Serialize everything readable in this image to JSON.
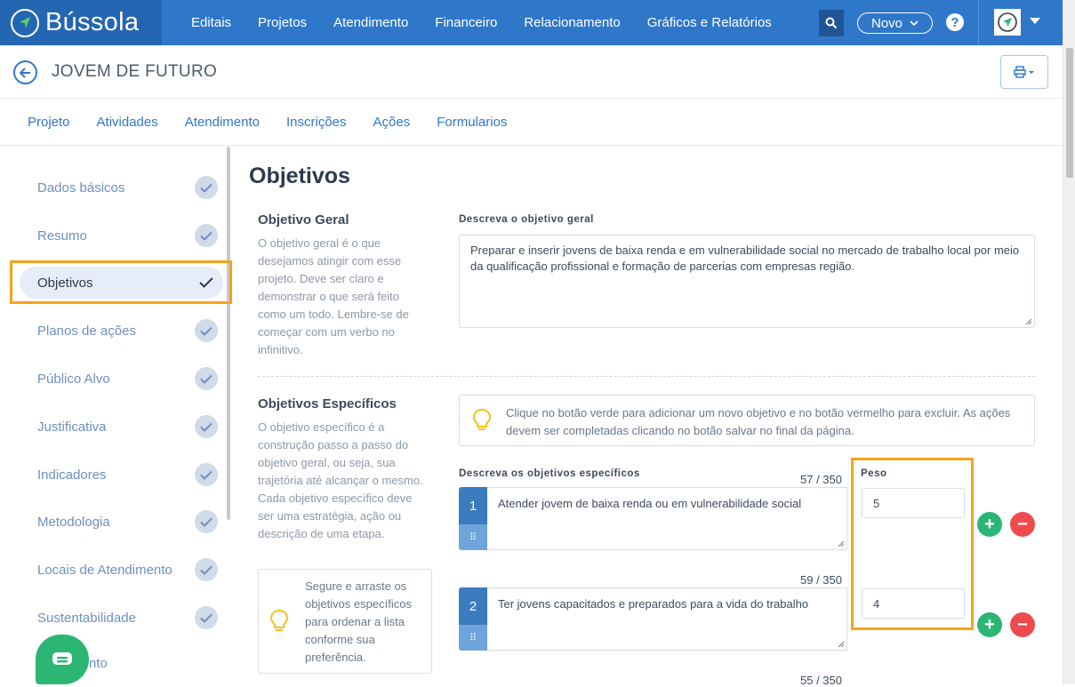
{
  "app": {
    "name": "Bússola"
  },
  "nav": {
    "items": [
      "Editais",
      "Projetos",
      "Atendimento",
      "Financeiro",
      "Relacionamento",
      "Gráficos e Relatórios"
    ],
    "novo_label": "Novo",
    "help_label": "?"
  },
  "page": {
    "title": "JOVEM DE FUTURO"
  },
  "tabs": [
    "Projeto",
    "Atividades",
    "Atendimento",
    "Inscrições",
    "Ações",
    "Formularios"
  ],
  "sidebar": {
    "items": [
      {
        "label": "Dados básicos"
      },
      {
        "label": "Resumo"
      },
      {
        "label": "Objetivos"
      },
      {
        "label": "Planos de ações"
      },
      {
        "label": "Público Alvo"
      },
      {
        "label": "Justificativa"
      },
      {
        "label": "Indicadores"
      },
      {
        "label": "Metodologia"
      },
      {
        "label": "Locais de Atendimento"
      },
      {
        "label": "Sustentabilidade"
      }
    ],
    "partial_label": "nto"
  },
  "content": {
    "title": "Objetivos",
    "geral": {
      "title": "Objetivo Geral",
      "description": "O objetivo geral é o que desejamos atingir com esse projeto. Deve ser claro e demonstrar o que será feito como um todo. Lembre-se de começar com um verbo no infinitivo.",
      "label": "Descreva o objetivo geral",
      "value": "Preparar e inserir jovens de baixa renda e em vulnerabilidade social no mercado de trabalho local por meio da qualificação profissional e formação de parcerias com empresas região."
    },
    "especificos": {
      "title": "Objetivos Específicos",
      "description": "O objetivo específico é a construção passo a passo do objetivo geral, ou seja, sua trajetória até alcançar o mesmo. Cada objetivo específico deve ser uma estratégia, ação ou descrição de uma etapa.",
      "tip": "Clique no botão verde para adicionar um novo objetivo e no botão vermelho para excluir. As ações devem ser completadas clicando no botão salvar no final da página.",
      "drag_tip": "Segure e arraste os objetivos específicos para ordenar a lista conforme sua preferência.",
      "label": "Descreva os objetivos específicos",
      "peso_label": "Peso",
      "items": [
        {
          "num": "1",
          "text": "Atender jovem de baixa renda ou em vulnerabilidade social",
          "counter": "57 / 350",
          "peso": "5"
        },
        {
          "num": "2",
          "text": "Ter jovens capacitados e preparados para a vida do trabalho",
          "counter": "59 / 350",
          "peso": "4"
        }
      ],
      "next_counter": "55 / 350"
    }
  },
  "icons": {
    "search": "search-icon",
    "print": "print-icon",
    "back": "arrow-left-icon",
    "check": "check-icon",
    "bulb": "lightbulb-icon",
    "chat": "chat-icon"
  },
  "colors": {
    "primary": "#2f77c9",
    "brand_dark": "#2566b2",
    "accent_highlight": "#f7a21b",
    "add": "#2bb673",
    "remove": "#ee4b4f"
  }
}
